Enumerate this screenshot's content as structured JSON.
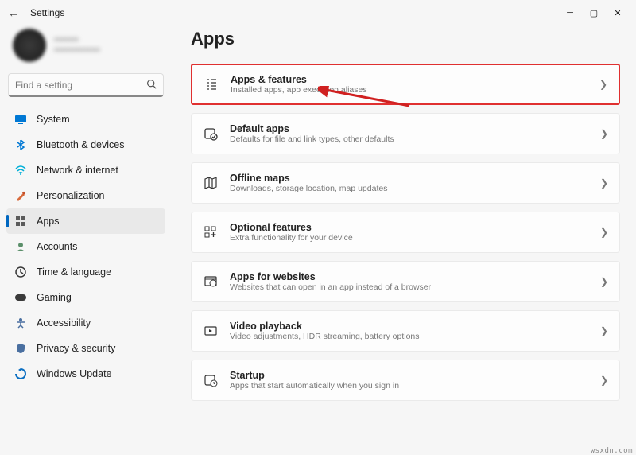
{
  "titlebar": {
    "title": "Settings"
  },
  "account": {
    "name": "••••••••",
    "email": "•••••••••••••••"
  },
  "search": {
    "placeholder": "Find a setting"
  },
  "sidebar": {
    "items": [
      {
        "label": "System",
        "icon": "system",
        "color": "#0078d4",
        "active": false
      },
      {
        "label": "Bluetooth & devices",
        "icon": "bluetooth",
        "color": "#0078d4",
        "active": false
      },
      {
        "label": "Network & internet",
        "icon": "network",
        "color": "#00b0d8",
        "active": false
      },
      {
        "label": "Personalization",
        "icon": "personalization",
        "color": "#d86b3c",
        "active": false
      },
      {
        "label": "Apps",
        "icon": "apps",
        "color": "#5b5b5b",
        "active": true
      },
      {
        "label": "Accounts",
        "icon": "accounts",
        "color": "#5b8f6a",
        "active": false
      },
      {
        "label": "Time & language",
        "icon": "time",
        "color": "#3a3a3a",
        "active": false
      },
      {
        "label": "Gaming",
        "icon": "gaming",
        "color": "#3a3a3a",
        "active": false
      },
      {
        "label": "Accessibility",
        "icon": "accessibility",
        "color": "#4a6fa0",
        "active": false
      },
      {
        "label": "Privacy & security",
        "icon": "privacy",
        "color": "#4a6fa0",
        "active": false
      },
      {
        "label": "Windows Update",
        "icon": "update",
        "color": "#0b6fc2",
        "active": false
      }
    ]
  },
  "main": {
    "heading": "Apps",
    "cards": [
      {
        "title": "Apps & features",
        "desc": "Installed apps, app execution aliases",
        "icon": "apps-features",
        "highlight": true
      },
      {
        "title": "Default apps",
        "desc": "Defaults for file and link types, other defaults",
        "icon": "default-apps",
        "highlight": false
      },
      {
        "title": "Offline maps",
        "desc": "Downloads, storage location, map updates",
        "icon": "offline-maps",
        "highlight": false
      },
      {
        "title": "Optional features",
        "desc": "Extra functionality for your device",
        "icon": "optional-features",
        "highlight": false
      },
      {
        "title": "Apps for websites",
        "desc": "Websites that can open in an app instead of a browser",
        "icon": "apps-websites",
        "highlight": false
      },
      {
        "title": "Video playback",
        "desc": "Video adjustments, HDR streaming, battery options",
        "icon": "video-playback",
        "highlight": false
      },
      {
        "title": "Startup",
        "desc": "Apps that start automatically when you sign in",
        "icon": "startup",
        "highlight": false
      }
    ]
  },
  "watermark": "wsxdn.com"
}
